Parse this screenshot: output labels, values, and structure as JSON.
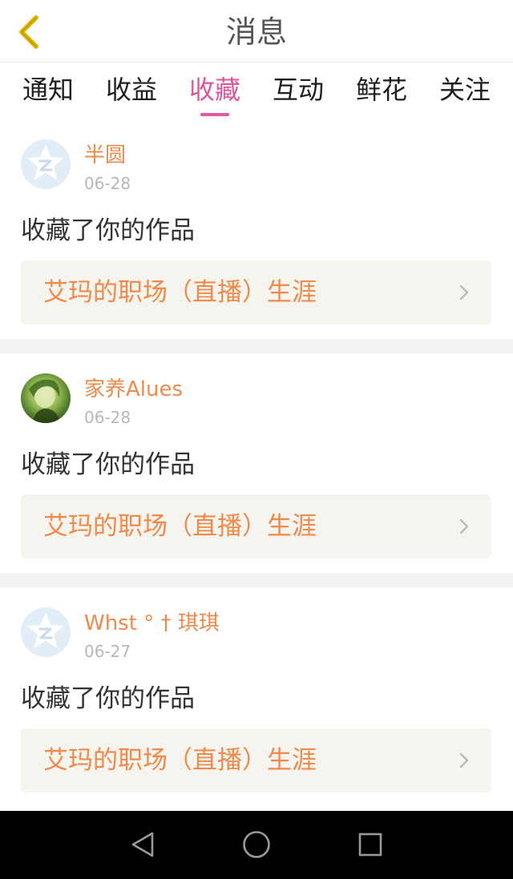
{
  "header": {
    "title": "消息"
  },
  "tabs": [
    {
      "label": "通知",
      "active": false
    },
    {
      "label": "收益",
      "active": false
    },
    {
      "label": "收藏",
      "active": true
    },
    {
      "label": "互动",
      "active": false
    },
    {
      "label": "鲜花",
      "active": false
    },
    {
      "label": "关注",
      "active": false
    }
  ],
  "items": [
    {
      "user": "半圆",
      "date": "06-28",
      "action": "收藏了你的作品",
      "work": "艾玛的职场（直播）生涯",
      "avatar": "default-avatar"
    },
    {
      "user": "家养Alues",
      "date": "06-28",
      "action": "收藏了你的作品",
      "work": "艾玛的职场（直播）生涯",
      "avatar": "photo-avatar"
    },
    {
      "user": "Whst ° † 琪琪",
      "date": "06-27",
      "action": "收藏了你的作品",
      "work": "艾玛的职场（直播）生涯",
      "avatar": "default-avatar"
    }
  ],
  "icons": {
    "back": "chevron-left-icon",
    "chevron": "chevron-right-icon",
    "nav_back": "triangle-back-icon",
    "nav_home": "circle-home-icon",
    "nav_recents": "square-recents-icon"
  },
  "colors": {
    "accent": "#e0559b",
    "username": "#f08a4b",
    "back_icon": "#e6b800",
    "card_bg": "#f5f4ee",
    "separator": "#f2f2f2"
  }
}
